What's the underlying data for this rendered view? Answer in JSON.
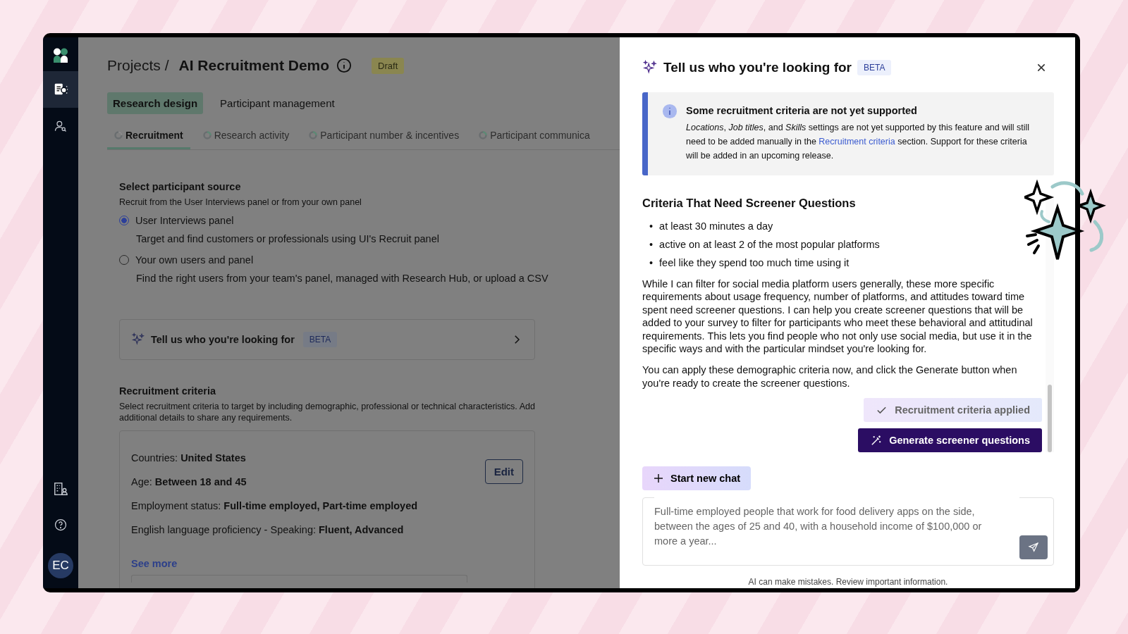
{
  "sidebar": {
    "nav_items": [
      {
        "selected": true
      },
      {
        "selected": false
      }
    ],
    "avatar": "EC"
  },
  "header": {
    "breadcrumb": "Projects /",
    "title": "AI Recruitment Demo",
    "status": "Draft"
  },
  "tabs": [
    {
      "label": "Research design",
      "selected": true
    },
    {
      "label": "Participant management",
      "selected": false
    }
  ],
  "sub_tabs": [
    {
      "label": "Recruitment",
      "selected": true
    },
    {
      "label": "Research activity",
      "selected": false
    },
    {
      "label": "Participant number & incentives",
      "selected": false
    },
    {
      "label": "Participant communica",
      "selected": false
    }
  ],
  "participant_source": {
    "title": "Select participant source",
    "description": "Recruit from the User Interviews panel or from your own panel",
    "options": [
      {
        "label": "User Interviews panel",
        "description": "Target and find customers or professionals using UI's Recruit panel",
        "selected": true
      },
      {
        "label": "Your own users and panel",
        "description": "Find the right users from your team's panel, managed with Research Hub, or upload a CSV",
        "selected": false
      }
    ]
  },
  "ai_card": {
    "title": "Tell us who you're looking for",
    "badge": "BETA"
  },
  "recruitment_criteria": {
    "title": "Recruitment criteria",
    "description": "Select recruitment criteria to target by including demographic, professional or technical characteristics. Add additional details to share any requirements.",
    "items": [
      "Countries: **United States**",
      "Age: **Between 18 and 45**",
      "Employment status: **Full-time employed, Part-time employed**",
      "English language proficiency - Speaking: **Fluent, Advanced**"
    ],
    "edit_button": "Edit",
    "see_more": "See more"
  },
  "panel": {
    "title": "Tell us who you're looking for",
    "badge": "BETA",
    "alert": {
      "title": "Some recruitment criteria are not yet supported",
      "text_start": "*Locations*, *Job titles*, and *Skills* settings are not yet supported by this feature and will still need to be added manually in the ",
      "link": "Recruitment criteria",
      "text_end": " section. Support for these criteria will be added in an upcoming release."
    },
    "heading": "Criteria That Need Screener Questions",
    "bullets": [
      {
        "marker": "•",
        "text": "at least 30 minutes a day"
      },
      {
        "marker": "•",
        "text": "active on at least 2 of the most popular platforms"
      },
      {
        "marker": "•",
        "text": "feel like they spend too much time using it"
      }
    ],
    "paragraphs": [
      "While I can filter for social media platform users generally, these more specific requirements about usage frequency, number of platforms, and attitudes toward time spent need screener questions. I can help you create screener questions that will be added to your survey to filter for participants who meet these behavioral and attitudinal requirements. This lets you find people who not only use social media, but use it in the specific ways and with the particular mindset you're looking for.",
      "You can apply these demographic criteria now, and click the Generate button when you're ready to create the screener questions."
    ],
    "applied_button": {
      "label": "Recruitment criteria applied",
      "disabled": true
    },
    "generate_button": "Generate screener questions",
    "new_chat_button": "Start new chat",
    "input": {
      "placeholder": "Full-time employed people that work for food delivery apps on the side, between the ages of 25 and 40, with a household income of $100,000 or more a year..."
    },
    "disclaimer": "AI can make mistakes. Review important information."
  }
}
